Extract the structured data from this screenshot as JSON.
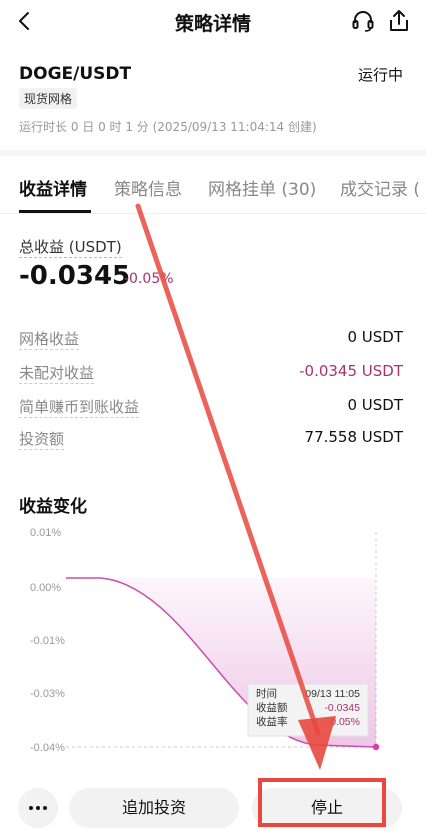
{
  "header": {
    "title": "策略详情",
    "back_icon": "back-arrow-icon",
    "support_icon": "headset-icon",
    "share_icon": "share-icon"
  },
  "strategy": {
    "pair": "DOGE/USDT",
    "status": "运行中",
    "tag": "现货网格",
    "runtime": "运行时长 0 日 0 时 1 分 (2025/09/13 11:04:14 创建)"
  },
  "tabs": [
    {
      "label": "收益详情",
      "active": true
    },
    {
      "label": "策略信息",
      "active": false
    },
    {
      "label": "网格挂单 (30)",
      "active": false
    },
    {
      "label": "成交记录 (",
      "active": false
    }
  ],
  "summary": {
    "total_label": "总收益 (USDT)",
    "total_value": "-0.0345",
    "total_pct": "-0.05%"
  },
  "metrics": [
    {
      "label": "网格收益",
      "value": "0 USDT"
    },
    {
      "label": "未配对收益",
      "value": "-0.0345 USDT"
    },
    {
      "label": "简单赚币到账收益",
      "value": "0 USDT"
    },
    {
      "label": "投资额",
      "value": "77.558 USDT"
    }
  ],
  "colors": {
    "accent": "#a8326e",
    "line": "#c84db0",
    "annotation": "#e8483e"
  },
  "chart_title": "收益变化",
  "chart_data": {
    "type": "area",
    "y_tick_labels": [
      "0.01%",
      "0.00%",
      "-0.01%",
      "-0.03%",
      "-0.04%"
    ],
    "ylim": [
      -0.05,
      0.01
    ],
    "points": [
      {
        "t": 0.0,
        "y": 0.0
      },
      {
        "t": 0.25,
        "y": -0.006
      },
      {
        "t": 0.5,
        "y": -0.03
      },
      {
        "t": 0.75,
        "y": -0.047
      },
      {
        "t": 1.0,
        "y": -0.05
      }
    ],
    "grid": "dashed",
    "tooltip": {
      "rows": [
        {
          "label": "时间",
          "value": "09/13 11:05"
        },
        {
          "label": "收益额",
          "value": "-0.0345"
        },
        {
          "label": "收益率",
          "value": "-0.05%"
        }
      ]
    }
  },
  "bottom": {
    "more_icon": "more-dots-icon",
    "add_label": "追加投资",
    "stop_label": "停止"
  }
}
